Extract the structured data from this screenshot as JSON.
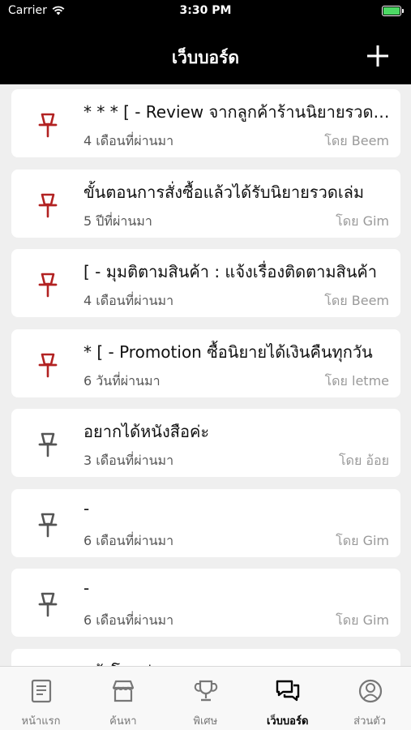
{
  "status_bar": {
    "carrier": "Carrier",
    "time": "3:30 PM"
  },
  "header": {
    "title": "เว็บบอร์ด",
    "add_icon": "plus-icon"
  },
  "colors": {
    "header_bg": "#000000",
    "pinned": "#b22222",
    "unpinned": "#555555",
    "accent_battery": "#4cd964"
  },
  "posts": [
    {
      "title": "* * * [ - Review จากลูกค้าร้านนิยายรวดเล่ม",
      "time": "4 เดือนที่ผ่านมา",
      "author": "โดย Beem",
      "pinned": true
    },
    {
      "title": "ขั้นตอนการสั่งซื้อแล้วได้รับนิยายรวดเล่ม",
      "time": "5 ปีที่ผ่านมา",
      "author": "โดย Gim",
      "pinned": true
    },
    {
      "title": "[ - มุมติตามสินค้า : แจ้งเรื่องติดตามสินค้า",
      "time": "4 เดือนที่ผ่านมา",
      "author": "โดย Beem",
      "pinned": true
    },
    {
      "title": "* [ - Promotion ซื้อนิยายได้เงินคืนทุกวัน",
      "time": "6 วันที่ผ่านมา",
      "author": "โดย letme",
      "pinned": true
    },
    {
      "title": "อยากได้หนังสือค่ะ",
      "time": "3 เดือนที่ผ่านมา",
      "author": "โดย อ้อย",
      "pinned": false
    },
    {
      "title": "-",
      "time": "6 เดือนที่ผ่านมา",
      "author": "โดย Gim",
      "pinned": false
    },
    {
      "title": "-",
      "time": "6 เดือนที่ผ่านมา",
      "author": "โดย Gim",
      "pinned": false
    },
    {
      "title": "แจ้งโอนค่ะ",
      "time": "",
      "author": "",
      "pinned": false
    }
  ],
  "tabs": [
    {
      "label": "หน้าแรก",
      "icon": "document-icon",
      "active": false
    },
    {
      "label": "ค้นหา",
      "icon": "store-icon",
      "active": false
    },
    {
      "label": "พิเศษ",
      "icon": "trophy-icon",
      "active": false
    },
    {
      "label": "เว็บบอร์ด",
      "icon": "chat-bubbles-icon",
      "active": true
    },
    {
      "label": "ส่วนตัว",
      "icon": "user-icon",
      "active": false
    }
  ]
}
